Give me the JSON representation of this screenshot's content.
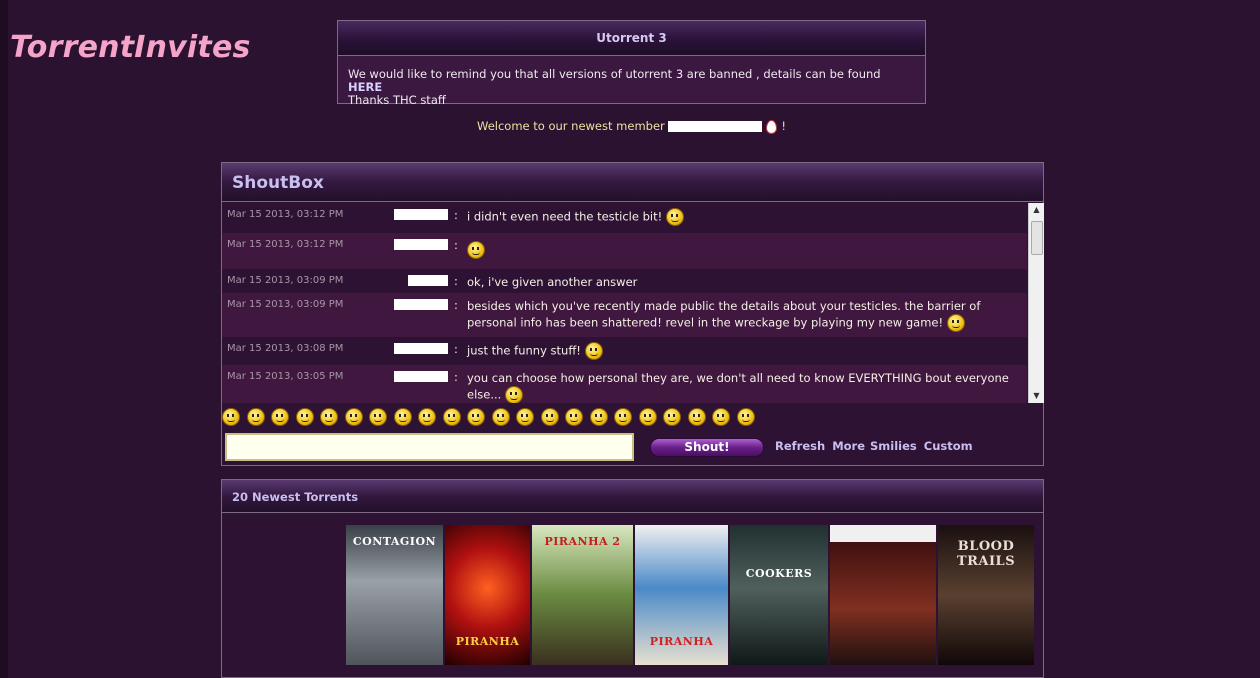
{
  "site": {
    "logo": "TorrentInvites"
  },
  "notice": {
    "title": "Utorrent 3",
    "message": "We would like to remind you that all versions of utorrent 3 are banned , details can be found ",
    "link_label": "HERE",
    "signature": "Thanks THC staff"
  },
  "welcome": {
    "prefix": "Welcome to our newest member",
    "suffix": "!"
  },
  "shoutbox": {
    "title": "ShoutBox",
    "messages": [
      {
        "time": "Mar 15 2013, 03:12 PM",
        "text": "i didn't even need the testicle bit!"
      },
      {
        "time": "Mar 15 2013, 03:12 PM",
        "text": ""
      },
      {
        "time": "Mar 15 2013, 03:09 PM",
        "text": "ok, i've given another answer"
      },
      {
        "time": "Mar 15 2013, 03:09 PM",
        "text": "besides which you've recently made public the details about your testicles. the barrier of personal info has been shattered! revel in the wreckage by playing my new game!"
      },
      {
        "time": "Mar 15 2013, 03:08 PM",
        "text": "just the funny stuff!"
      },
      {
        "time": "Mar 15 2013, 03:05 PM",
        "text": "you can choose how personal they are, we don't all need to know EVERYTHING bout everyone else..."
      }
    ],
    "shout_button": "Shout!",
    "links": [
      "Refresh",
      "More Smilies",
      "Custom"
    ]
  },
  "torrents": {
    "title": "20 Newest Torrents",
    "posters": [
      "CONTAGION",
      "PIRANHA",
      "PIRANHA 2",
      "PIRANHA",
      "COOKERS",
      "",
      "BLOOD TRAILS"
    ]
  },
  "colors": {
    "background": "#2a1230",
    "logo": "#f5a3c8",
    "header_text": "#c8bff0"
  }
}
